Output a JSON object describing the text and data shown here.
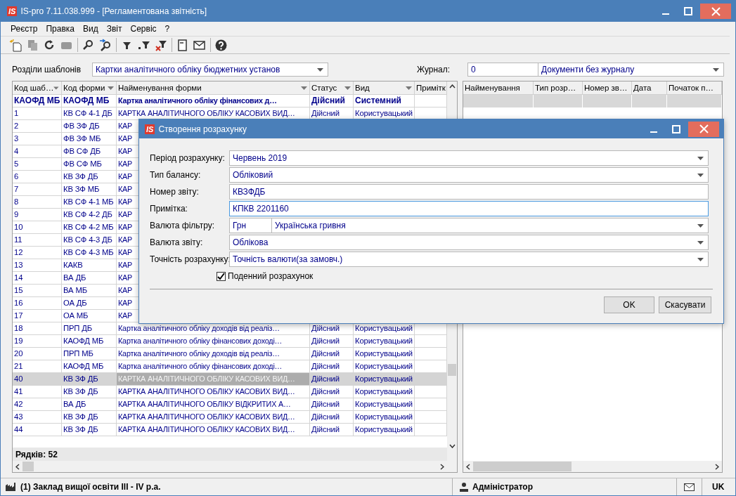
{
  "window": {
    "logo": "IS",
    "title": "IS-pro 7.11.038.999 - [Регламентована звітність]"
  },
  "menu": [
    {
      "label": "Реєстр"
    },
    {
      "label": "Правка"
    },
    {
      "label": "Вид"
    },
    {
      "label": "Звіт"
    },
    {
      "label": "Сервіс"
    },
    {
      "label": "?"
    }
  ],
  "template_sections": {
    "label": "Розділи шаблонів",
    "value": "Картки аналітичного обліку бюджетних установ"
  },
  "journal": {
    "label": "Журнал:",
    "code": "0",
    "value": "Документи без журналу"
  },
  "templates_table": {
    "columns": [
      {
        "label": "Код шаб…",
        "sortable": true
      },
      {
        "label": "Код форми",
        "sortable": true
      },
      {
        "label": "Найменування форми",
        "sortable": true
      },
      {
        "label": "Статус",
        "sortable": true
      },
      {
        "label": "Вид",
        "sortable": true
      },
      {
        "label": "Примітк"
      }
    ],
    "rows": [
      {
        "kind": "filter",
        "selected": false,
        "cells": [
          "КАОФД МБ",
          "КАОФД МБ",
          "Картка аналітичного обліку фінансових д…",
          "Дійсний",
          "Системний"
        ]
      },
      {
        "kind": "item",
        "selected": false,
        "cells": [
          "1",
          "КВ СФ 4-1 ДБ",
          "КАРТКА АНАЛІТИЧНОГО ОБЛІКУ КАСОВИХ ВИД…",
          "Дійсний",
          "Користувацький"
        ]
      },
      {
        "kind": "item",
        "selected": false,
        "cells": [
          "2",
          "ФВ ЗФ ДБ",
          "КАР"
        ]
      },
      {
        "kind": "item",
        "selected": false,
        "cells": [
          "3",
          "ФВ ЗФ МБ",
          "КАР"
        ]
      },
      {
        "kind": "item",
        "selected": false,
        "cells": [
          "4",
          "ФВ СФ ДБ",
          "КАР"
        ]
      },
      {
        "kind": "item",
        "selected": false,
        "cells": [
          "5",
          "ФВ СФ МБ",
          "КАР"
        ]
      },
      {
        "kind": "item",
        "selected": false,
        "cells": [
          "6",
          "КВ ЗФ ДБ",
          "КАР"
        ]
      },
      {
        "kind": "item",
        "selected": false,
        "cells": [
          "7",
          "КВ ЗФ МБ",
          "КАР"
        ]
      },
      {
        "kind": "item",
        "selected": false,
        "cells": [
          "8",
          "КВ СФ 4-1 МБ",
          "КАР"
        ]
      },
      {
        "kind": "item",
        "selected": false,
        "cells": [
          "9",
          "КВ СФ 4-2 ДБ",
          "КАР"
        ]
      },
      {
        "kind": "item",
        "selected": false,
        "cells": [
          "10",
          "КВ СФ 4-2 МБ",
          "КАР"
        ]
      },
      {
        "kind": "item",
        "selected": false,
        "cells": [
          "11",
          "КВ СФ 4-3 ДБ",
          "КАР"
        ]
      },
      {
        "kind": "item",
        "selected": false,
        "cells": [
          "12",
          "КВ СФ 4-3 МБ",
          "КАР"
        ]
      },
      {
        "kind": "item",
        "selected": false,
        "cells": [
          "13",
          "КАКВ",
          "КАР"
        ]
      },
      {
        "kind": "item",
        "selected": false,
        "cells": [
          "14",
          "ВА ДБ",
          "КАР"
        ]
      },
      {
        "kind": "item",
        "selected": false,
        "cells": [
          "15",
          "ВА МБ",
          "КАР"
        ]
      },
      {
        "kind": "item",
        "selected": false,
        "cells": [
          "16",
          "ОА ДБ",
          "КАР"
        ]
      },
      {
        "kind": "item",
        "selected": false,
        "cells": [
          "17",
          "ОА МБ",
          "КАР"
        ]
      },
      {
        "kind": "item",
        "selected": false,
        "cells": [
          "18",
          "ПРП ДБ",
          "Картка аналітичного обліку доходів від реаліз…",
          "Дійсний",
          "Користувацький"
        ]
      },
      {
        "kind": "item",
        "selected": false,
        "cells": [
          "19",
          "КАОФД МБ",
          "Картка аналітичного обліку фінансових доході…",
          "Дійсний",
          "Користувацький"
        ]
      },
      {
        "kind": "item",
        "selected": false,
        "cells": [
          "20",
          "ПРП МБ",
          "Картка аналітичного обліку доходів від реаліз…",
          "Дійсний",
          "Користувацький"
        ]
      },
      {
        "kind": "item",
        "selected": false,
        "cells": [
          "21",
          "КАОФД МБ",
          "Картка аналітичного обліку фінансових доході…",
          "Дійсний",
          "Користувацький"
        ]
      },
      {
        "kind": "item",
        "selected": true,
        "cells": [
          "40",
          "КВ ЗФ ДБ",
          "КАРТКА АНАЛІТИЧНОГО ОБЛІКУ КАСОВИХ ВИД…",
          "Дійсний",
          "Користувацький"
        ]
      },
      {
        "kind": "item",
        "selected": false,
        "cells": [
          "41",
          "КВ ЗФ ДБ",
          "КАРТКА АНАЛІТИЧНОГО ОБЛІКУ КАСОВИХ ВИД…",
          "Дійсний",
          "Користувацький"
        ]
      },
      {
        "kind": "item",
        "selected": false,
        "cells": [
          "42",
          "ВА ДБ",
          "КАРТКА АНАЛІТИЧНОГО ОБЛІКУ ВІДКРИТИХ А…",
          "Дійсний",
          "Користувацький"
        ]
      },
      {
        "kind": "item",
        "selected": false,
        "cells": [
          "43",
          "КВ ЗФ ДБ",
          "КАРТКА АНАЛІТИЧНОГО ОБЛІКУ КАСОВИХ ВИД…",
          "Дійсний",
          "Користувацький"
        ]
      },
      {
        "kind": "item",
        "selected": false,
        "cells": [
          "44",
          "КВ ЗФ ДБ",
          "КАРТКА АНАЛІТИЧНОГО ОБЛІКУ КАСОВИХ ВИД…",
          "Дійсний",
          "Користувацький"
        ]
      }
    ],
    "footer": "Рядків: 52"
  },
  "documents_table": {
    "columns": [
      {
        "label": "Найменування"
      },
      {
        "label": "Тип розр…"
      },
      {
        "label": "Номер зв…"
      },
      {
        "label": "Дата"
      },
      {
        "label": "Початок п…"
      }
    ]
  },
  "dialog": {
    "logo": "IS",
    "title": "Створення розрахунку",
    "fields": [
      {
        "kind": "select",
        "label": "Період розрахунку:",
        "value": "Червень 2019",
        "focused": false
      },
      {
        "kind": "select",
        "label": "Тип балансу:",
        "value": "Обліковий",
        "focused": false
      },
      {
        "kind": "text",
        "label": "Номер звіту:",
        "value": "КВЗФДБ",
        "focused": false
      },
      {
        "kind": "text",
        "label": "Примітка:",
        "value": "КПКВ 2201160",
        "focused": true
      },
      {
        "kind": "currency",
        "label": "Валюта фільтру:",
        "code": "Грн",
        "value": "Українська гривня",
        "focused": false
      },
      {
        "kind": "select",
        "label": "Валюта звіту:",
        "value": "Облікова",
        "focused": false
      },
      {
        "kind": "select",
        "label": "Точність розрахунку:",
        "value": "Точність валюти(за замовч.)",
        "focused": false
      }
    ],
    "checkbox": {
      "label": "Поденний розрахунок",
      "checked": true
    },
    "buttons": [
      {
        "label": "OK"
      },
      {
        "label": "Скасувати"
      }
    ]
  },
  "status_bar": {
    "organization": "(1) Заклад вищої освіти III - IV р.а.",
    "user": "Адміністратор",
    "language": "UK"
  }
}
